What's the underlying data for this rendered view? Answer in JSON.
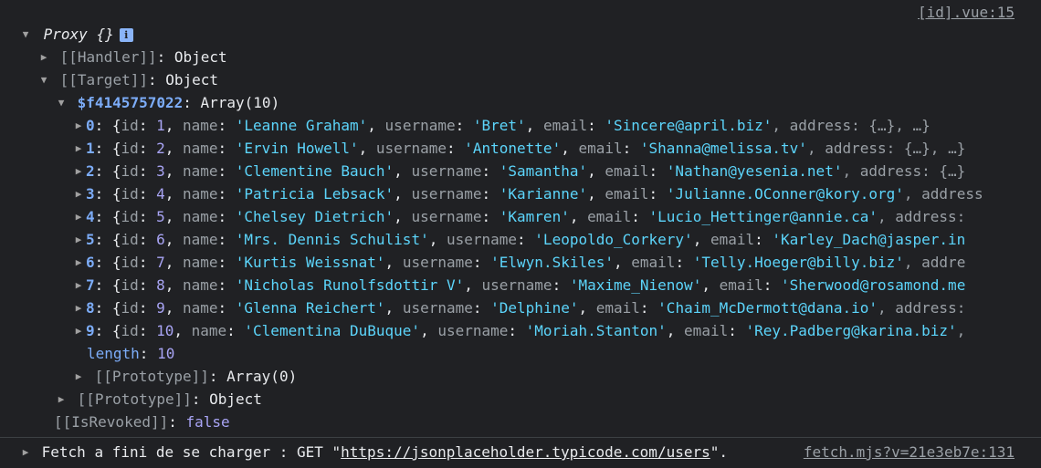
{
  "source_top": "[id].vue:15",
  "proxy_label": "Proxy {}",
  "info_icon_char": "i",
  "handler": {
    "key": "[[Handler]]",
    "value": "Object"
  },
  "target": {
    "key": "[[Target]]",
    "value": "Object"
  },
  "array": {
    "key": "$f4145757022",
    "value": "Array(10)"
  },
  "rows": [
    {
      "index": "0",
      "id": "1",
      "name": "'Leanne Graham'",
      "username": "'Bret'",
      "email": "'Sincere@april.biz'",
      "tail": ", address: {…}, …}"
    },
    {
      "index": "1",
      "id": "2",
      "name": "'Ervin Howell'",
      "username": "'Antonette'",
      "email": "'Shanna@melissa.tv'",
      "tail": ", address: {…}, …}"
    },
    {
      "index": "2",
      "id": "3",
      "name": "'Clementine Bauch'",
      "username": "'Samantha'",
      "email": "'Nathan@yesenia.net'",
      "tail": ", address: {…}"
    },
    {
      "index": "3",
      "id": "4",
      "name": "'Patricia Lebsack'",
      "username": "'Karianne'",
      "email": "'Julianne.OConner@kory.org'",
      "tail": ", address"
    },
    {
      "index": "4",
      "id": "5",
      "name": "'Chelsey Dietrich'",
      "username": "'Kamren'",
      "email": "'Lucio_Hettinger@annie.ca'",
      "tail": ", address:"
    },
    {
      "index": "5",
      "id": "6",
      "name": "'Mrs. Dennis Schulist'",
      "username": "'Leopoldo_Corkery'",
      "email": "'Karley_Dach@jasper.in",
      "tail": ""
    },
    {
      "index": "6",
      "id": "7",
      "name": "'Kurtis Weissnat'",
      "username": "'Elwyn.Skiles'",
      "email": "'Telly.Hoeger@billy.biz'",
      "tail": ", addre"
    },
    {
      "index": "7",
      "id": "8",
      "name": "'Nicholas Runolfsdottir V'",
      "username": "'Maxime_Nienow'",
      "email": "'Sherwood@rosamond.me",
      "tail": ""
    },
    {
      "index": "8",
      "id": "9",
      "name": "'Glenna Reichert'",
      "username": "'Delphine'",
      "email": "'Chaim_McDermott@dana.io'",
      "tail": ", address:"
    },
    {
      "index": "9",
      "id": "10",
      "name": "'Clementina DuBuque'",
      "username": "'Moriah.Stanton'",
      "email": "'Rey.Padberg@karina.biz'",
      "tail": ","
    }
  ],
  "field_labels": {
    "id": "id",
    "name": "name",
    "username": "username",
    "email": "email"
  },
  "length": {
    "key": "length",
    "value": "10"
  },
  "array_proto": {
    "key": "[[Prototype]]",
    "value": "Array(0)"
  },
  "object_proto": {
    "key": "[[Prototype]]",
    "value": "Object"
  },
  "revoked": {
    "key": "[[IsRevoked]]",
    "value": "false"
  },
  "fetch_line": {
    "prefix": "Fetch a fini de se charger : GET \"",
    "url": "https://jsonplaceholder.typicode.com/users",
    "suffix": "\".",
    "source": "fetch.mjs?v=21e3eb7e:131"
  },
  "colors": {
    "background": "#202124",
    "key": "#7cacf8",
    "string": "#5cd5fb",
    "number": "#a8a4f4",
    "muted": "#9aa0a6"
  },
  "icons": {
    "expanded": "triangle-down-icon",
    "collapsed": "triangle-right-icon",
    "info": "info-icon"
  }
}
